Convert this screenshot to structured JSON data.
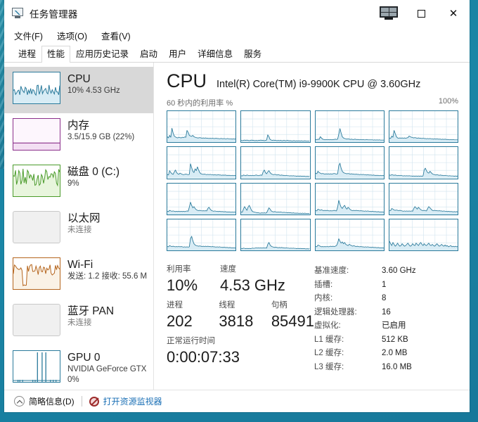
{
  "window": {
    "title": "任务管理器",
    "icon": "taskmanager-icon",
    "controls": {
      "monitor_label": "monitor-icon",
      "maximize_label": "▢",
      "close_label": "✕"
    }
  },
  "menu": {
    "items": [
      {
        "label": "文件(F)",
        "name": "menu-file"
      },
      {
        "label": "选项(O)",
        "name": "menu-options"
      },
      {
        "label": "查看(V)",
        "name": "menu-view"
      }
    ]
  },
  "tabs": {
    "active_index": 1,
    "items": [
      {
        "label": "进程",
        "name": "tab-processes"
      },
      {
        "label": "性能",
        "name": "tab-performance"
      },
      {
        "label": "应用历史记录",
        "name": "tab-app-history"
      },
      {
        "label": "启动",
        "name": "tab-startup"
      },
      {
        "label": "用户",
        "name": "tab-users"
      },
      {
        "label": "详细信息",
        "name": "tab-details"
      },
      {
        "label": "服务",
        "name": "tab-services"
      }
    ]
  },
  "sidebar": {
    "items": [
      {
        "name": "sidebar-item-cpu",
        "title": "CPU",
        "sub1": "10% 4.53 GHz",
        "sub2": "",
        "selected": true,
        "muted": false,
        "color": "#2a7a9b",
        "fill": "#d8ecf5",
        "style": "line"
      },
      {
        "name": "sidebar-item-memory",
        "title": "内存",
        "sub1": "3.5/15.9 GB (22%)",
        "sub2": "",
        "selected": false,
        "muted": false,
        "color": "#8b2f8b",
        "fill": "#fbf0fb",
        "style": "memory"
      },
      {
        "name": "sidebar-item-disk",
        "title": "磁盘 0 (C:)",
        "sub1": "9%",
        "sub2": "",
        "selected": false,
        "muted": false,
        "color": "#4a9b2a",
        "fill": "#e8f5dd",
        "style": "line"
      },
      {
        "name": "sidebar-item-ethernet",
        "title": "以太网",
        "sub1": "未连接",
        "sub2": "",
        "selected": false,
        "muted": true,
        "color": "#c8c8c8",
        "fill": "#f0f0f0",
        "style": "empty"
      },
      {
        "name": "sidebar-item-wifi",
        "title": "Wi-Fi",
        "sub1": "发送: 1.2 接收: 55.6 M",
        "sub2": "",
        "selected": false,
        "muted": false,
        "color": "#b5651d",
        "fill": "#faf2e6",
        "style": "line"
      },
      {
        "name": "sidebar-item-bluetooth-pan",
        "title": "蓝牙 PAN",
        "sub1": "未连接",
        "sub2": "",
        "selected": false,
        "muted": true,
        "color": "#c8c8c8",
        "fill": "#f0f0f0",
        "style": "empty"
      },
      {
        "name": "sidebar-item-gpu",
        "title": "GPU 0",
        "sub1": "NVIDIA GeForce GTX",
        "sub2": "0%",
        "selected": false,
        "muted": false,
        "color": "#2a7a9b",
        "fill": "#ffffff",
        "style": "spikes"
      }
    ]
  },
  "main": {
    "heading": "CPU",
    "subheading": "Intel(R) Core(TM) i9-9900K CPU @ 3.60GHz",
    "graph_left_label": "60 秒内的利用率 %",
    "graph_right_label": "100%",
    "stats": {
      "utilization": {
        "label": "利用率",
        "value": "10%"
      },
      "speed": {
        "label": "速度",
        "value": "4.53 GHz"
      },
      "processes": {
        "label": "进程",
        "value": "202"
      },
      "threads": {
        "label": "线程",
        "value": "3818"
      },
      "handles": {
        "label": "句柄",
        "value": "85491"
      },
      "uptime": {
        "label": "正常运行时间",
        "value": "0:00:07:33"
      }
    },
    "specs": [
      {
        "key": "基准速度:",
        "value": "3.60 GHz",
        "name": "spec-base-speed"
      },
      {
        "key": "插槽:",
        "value": "1",
        "name": "spec-sockets"
      },
      {
        "key": "内核:",
        "value": "8",
        "name": "spec-cores"
      },
      {
        "key": "逻辑处理器:",
        "value": "16",
        "name": "spec-logical-processors"
      },
      {
        "key": "虚拟化:",
        "value": "已启用",
        "name": "spec-virtualization"
      },
      {
        "key": "L1 缓存:",
        "value": "512 KB",
        "name": "spec-l1-cache"
      },
      {
        "key": "L2 缓存:",
        "value": "2.0 MB",
        "name": "spec-l2-cache"
      },
      {
        "key": "L3 缓存:",
        "value": "16.0 MB",
        "name": "spec-l3-cache"
      }
    ]
  },
  "footer": {
    "fewer_details": "简略信息(D)",
    "resource_monitor": "打开资源监视器"
  },
  "colors": {
    "accent": "#2a7a9b",
    "graph_fill": "#d8ecf5",
    "grid": "#cfe3ee",
    "link": "#1a6fb5",
    "selection": "#d8d8d8",
    "desktop": "#1a86a6"
  },
  "chart_data": {
    "type": "line",
    "title": "60 秒内的利用率 %",
    "ylabel": "%",
    "xlabel": "60 秒",
    "ylim": [
      0,
      100
    ],
    "grid": true,
    "legend": false,
    "note": "16 logical processor mini-graphs in a 4x4 grid; each shows CPU utilization over the last 60 seconds.",
    "panels": [
      {
        "name": "CPU 0",
        "values": [
          18,
          14,
          22,
          16,
          45,
          30,
          20,
          17,
          15,
          14,
          16,
          15,
          14,
          16,
          15,
          17,
          16,
          38,
          32,
          22,
          20,
          19,
          22,
          18,
          16,
          15,
          14,
          14,
          15,
          14,
          13,
          14,
          13,
          14,
          13,
          13,
          12,
          13,
          12,
          13,
          12,
          12,
          13,
          12,
          12,
          11,
          12,
          12,
          11,
          12,
          11,
          11,
          12,
          11,
          11,
          11,
          10,
          11,
          10,
          11
        ]
      },
      {
        "name": "CPU 1",
        "values": [
          6,
          5,
          6,
          7,
          6,
          7,
          6,
          5,
          6,
          7,
          6,
          6,
          5,
          6,
          5,
          6,
          6,
          7,
          6,
          6,
          5,
          6,
          7,
          24,
          18,
          9,
          7,
          6,
          7,
          6,
          6,
          5,
          6,
          5,
          6,
          5,
          5,
          6,
          5,
          5,
          6,
          5,
          5,
          5,
          4,
          5,
          5,
          4,
          5,
          4,
          5,
          4,
          5,
          4,
          4,
          5,
          4,
          4,
          4,
          4
        ]
      },
      {
        "name": "CPU 2",
        "values": [
          9,
          8,
          10,
          9,
          18,
          14,
          10,
          9,
          8,
          9,
          8,
          9,
          8,
          9,
          8,
          9,
          9,
          10,
          9,
          10,
          26,
          44,
          30,
          18,
          14,
          12,
          11,
          10,
          11,
          10,
          9,
          10,
          9,
          9,
          10,
          9,
          9,
          9,
          8,
          9,
          8,
          9,
          8,
          8,
          9,
          8,
          8,
          8,
          8,
          8,
          7,
          8,
          7,
          8,
          7,
          8,
          7,
          7,
          7,
          7
        ]
      },
      {
        "name": "CPU 3",
        "values": [
          14,
          12,
          20,
          16,
          38,
          28,
          18,
          14,
          13,
          14,
          13,
          14,
          13,
          14,
          13,
          14,
          15,
          20,
          18,
          16,
          15,
          14,
          15,
          14,
          13,
          14,
          13,
          13,
          12,
          13,
          12,
          12,
          11,
          12,
          11,
          12,
          11,
          11,
          10,
          11,
          10,
          11,
          10,
          10,
          10,
          9,
          10,
          9,
          10,
          9,
          9,
          9,
          8,
          9,
          8,
          9,
          8,
          8,
          8,
          8
        ]
      },
      {
        "name": "CPU 4",
        "values": [
          12,
          10,
          24,
          18,
          14,
          12,
          20,
          26,
          18,
          14,
          12,
          16,
          14,
          12,
          11,
          12,
          13,
          12,
          11,
          12,
          46,
          34,
          22,
          18,
          30,
          24,
          36,
          26,
          18,
          14,
          13,
          12,
          13,
          12,
          11,
          12,
          11,
          12,
          11,
          11,
          10,
          11,
          10,
          10,
          11,
          10,
          10,
          9,
          10,
          9,
          10,
          9,
          9,
          9,
          9,
          8,
          9,
          8,
          9,
          8
        ]
      },
      {
        "name": "CPU 5",
        "values": [
          8,
          7,
          10,
          9,
          8,
          10,
          9,
          8,
          9,
          8,
          9,
          8,
          9,
          10,
          9,
          8,
          9,
          10,
          9,
          20,
          26,
          18,
          14,
          20,
          24,
          18,
          14,
          12,
          11,
          12,
          11,
          10,
          11,
          10,
          9,
          10,
          9,
          9,
          8,
          9,
          8,
          8,
          7,
          8,
          7,
          8,
          7,
          7,
          6,
          7,
          6,
          7,
          6,
          6,
          6,
          6,
          5,
          6,
          5,
          6
        ]
      },
      {
        "name": "CPU 6",
        "values": [
          16,
          14,
          22,
          18,
          16,
          14,
          15,
          14,
          13,
          14,
          13,
          14,
          13,
          14,
          13,
          14,
          15,
          14,
          13,
          14,
          40,
          48,
          32,
          22,
          18,
          16,
          15,
          14,
          15,
          14,
          13,
          14,
          13,
          13,
          12,
          13,
          12,
          12,
          11,
          12,
          11,
          12,
          11,
          11,
          10,
          11,
          10,
          10,
          10,
          9,
          10,
          9,
          9,
          9,
          9,
          8,
          9,
          8,
          9,
          8
        ]
      },
      {
        "name": "CPU 7",
        "values": [
          10,
          9,
          11,
          10,
          9,
          10,
          9,
          8,
          9,
          8,
          9,
          8,
          7,
          8,
          7,
          8,
          7,
          8,
          7,
          7,
          6,
          7,
          6,
          7,
          6,
          7,
          6,
          7,
          6,
          7,
          26,
          32,
          24,
          18,
          16,
          22,
          18,
          14,
          12,
          11,
          10,
          11,
          10,
          9,
          10,
          9,
          9,
          8,
          9,
          8,
          8,
          7,
          8,
          7,
          7,
          7,
          6,
          7,
          6,
          7
        ]
      },
      {
        "name": "CPU 8",
        "values": [
          11,
          10,
          14,
          12,
          11,
          12,
          11,
          10,
          11,
          10,
          11,
          10,
          11,
          10,
          11,
          10,
          11,
          12,
          11,
          24,
          40,
          30,
          22,
          26,
          20,
          16,
          14,
          13,
          14,
          13,
          12,
          13,
          12,
          13,
          12,
          20,
          24,
          18,
          14,
          12,
          11,
          12,
          11,
          11,
          10,
          11,
          10,
          10,
          10,
          9,
          10,
          9,
          9,
          9,
          9,
          8,
          9,
          8,
          9,
          8
        ]
      },
      {
        "name": "CPU 9",
        "values": [
          9,
          8,
          18,
          26,
          20,
          14,
          24,
          30,
          22,
          14,
          10,
          9,
          8,
          7,
          6,
          6,
          5,
          5,
          6,
          5,
          6,
          5,
          6,
          14,
          22,
          18,
          12,
          10,
          9,
          10,
          9,
          8,
          9,
          8,
          9,
          8,
          7,
          8,
          7,
          7,
          6,
          7,
          6,
          6,
          5,
          6,
          5,
          5,
          5,
          5,
          4,
          5,
          4,
          5,
          4,
          5,
          4,
          4,
          4,
          4
        ]
      },
      {
        "name": "CPU 10",
        "values": [
          14,
          12,
          18,
          16,
          14,
          16,
          14,
          13,
          14,
          13,
          14,
          13,
          12,
          13,
          12,
          13,
          14,
          13,
          12,
          24,
          46,
          34,
          24,
          20,
          26,
          30,
          22,
          18,
          24,
          20,
          16,
          14,
          13,
          14,
          13,
          14,
          13,
          13,
          12,
          13,
          12,
          12,
          11,
          12,
          11,
          12,
          11,
          11,
          10,
          11,
          10,
          10,
          10,
          9,
          10,
          9,
          9,
          9,
          9,
          8
        ]
      },
      {
        "name": "CPU 11",
        "values": [
          14,
          13,
          20,
          18,
          15,
          14,
          15,
          14,
          13,
          14,
          13,
          12,
          11,
          12,
          11,
          12,
          11,
          12,
          11,
          12,
          11,
          20,
          26,
          22,
          18,
          24,
          20,
          16,
          14,
          13,
          14,
          13,
          12,
          20,
          26,
          22,
          18,
          14,
          13,
          14,
          13,
          13,
          12,
          13,
          12,
          12,
          11,
          12,
          11,
          11,
          10,
          11,
          10,
          10,
          10,
          9,
          10,
          9,
          10,
          9
        ]
      },
      {
        "name": "CPU 12",
        "values": [
          13,
          12,
          16,
          14,
          13,
          14,
          13,
          12,
          13,
          12,
          13,
          12,
          13,
          12,
          11,
          12,
          11,
          12,
          11,
          12,
          38,
          46,
          32,
          22,
          18,
          16,
          15,
          14,
          15,
          14,
          13,
          14,
          13,
          14,
          13,
          14,
          13,
          13,
          12,
          13,
          12,
          12,
          11,
          12,
          11,
          12,
          11,
          11,
          10,
          11,
          10,
          10,
          10,
          9,
          10,
          9,
          9,
          9,
          9,
          8
        ]
      },
      {
        "name": "CPU 13",
        "values": [
          7,
          6,
          8,
          7,
          6,
          7,
          6,
          7,
          6,
          7,
          8,
          7,
          8,
          9,
          8,
          9,
          8,
          9,
          8,
          9,
          8,
          9,
          8,
          20,
          26,
          18,
          14,
          12,
          11,
          10,
          11,
          10,
          9,
          10,
          9,
          10,
          9,
          9,
          8,
          9,
          8,
          8,
          7,
          8,
          7,
          8,
          7,
          7,
          6,
          7,
          6,
          7,
          6,
          6,
          6,
          6,
          5,
          6,
          5,
          6
        ]
      },
      {
        "name": "CPU 14",
        "values": [
          14,
          12,
          18,
          16,
          14,
          12,
          13,
          12,
          13,
          12,
          13,
          12,
          13,
          14,
          13,
          14,
          13,
          14,
          16,
          24,
          38,
          30,
          24,
          28,
          22,
          26,
          20,
          18,
          16,
          20,
          18,
          16,
          14,
          16,
          14,
          13,
          14,
          13,
          12,
          13,
          12,
          12,
          11,
          12,
          11,
          12,
          11,
          11,
          10,
          11,
          10,
          10,
          10,
          9,
          10,
          9,
          9,
          9,
          9,
          8
        ]
      },
      {
        "name": "CPU 15",
        "values": [
          30,
          22,
          16,
          26,
          20,
          14,
          18,
          24,
          18,
          14,
          16,
          22,
          18,
          14,
          16,
          20,
          24,
          18,
          14,
          16,
          22,
          18,
          16,
          24,
          20,
          16,
          22,
          26,
          20,
          16,
          22,
          18,
          16,
          20,
          24,
          18,
          16,
          20,
          16,
          14,
          18,
          22,
          18,
          14,
          16,
          20,
          16,
          14,
          18,
          14,
          16,
          12,
          14,
          16,
          12,
          14,
          12,
          14,
          12,
          13
        ]
      }
    ]
  }
}
